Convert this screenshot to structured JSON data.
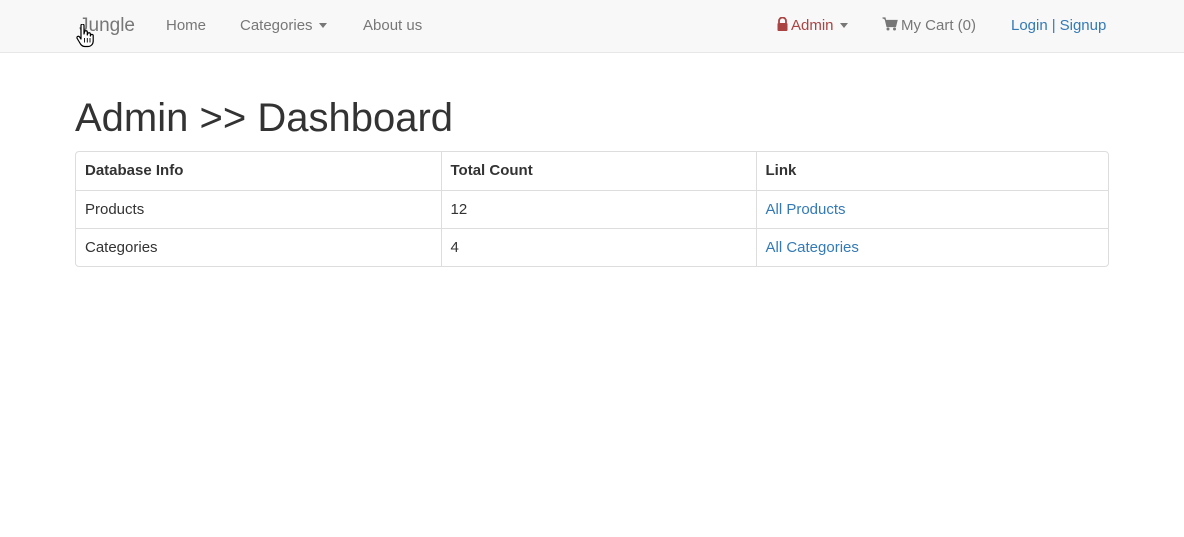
{
  "navbar": {
    "brand": "Jungle",
    "home": "Home",
    "categories": "Categories",
    "about": "About us",
    "admin": "Admin",
    "cart": "My Cart (0)",
    "login": "Login",
    "separator": "|",
    "signup": "Signup"
  },
  "page": {
    "title": "Admin >> Dashboard"
  },
  "table": {
    "headers": [
      "Database Info",
      "Total Count",
      "Link"
    ],
    "rows": [
      {
        "info": "Products",
        "count": "12",
        "link": "All Products"
      },
      {
        "info": "Categories",
        "count": "4",
        "link": "All Categories"
      }
    ]
  },
  "colors": {
    "navbar_bg": "#f8f8f8",
    "link": "#337ab7",
    "admin": "#a94442",
    "nav_text": "#777777"
  },
  "icons": {
    "admin": "lock-icon",
    "cart": "shopping-cart-icon",
    "categories": "caret-down-icon"
  }
}
